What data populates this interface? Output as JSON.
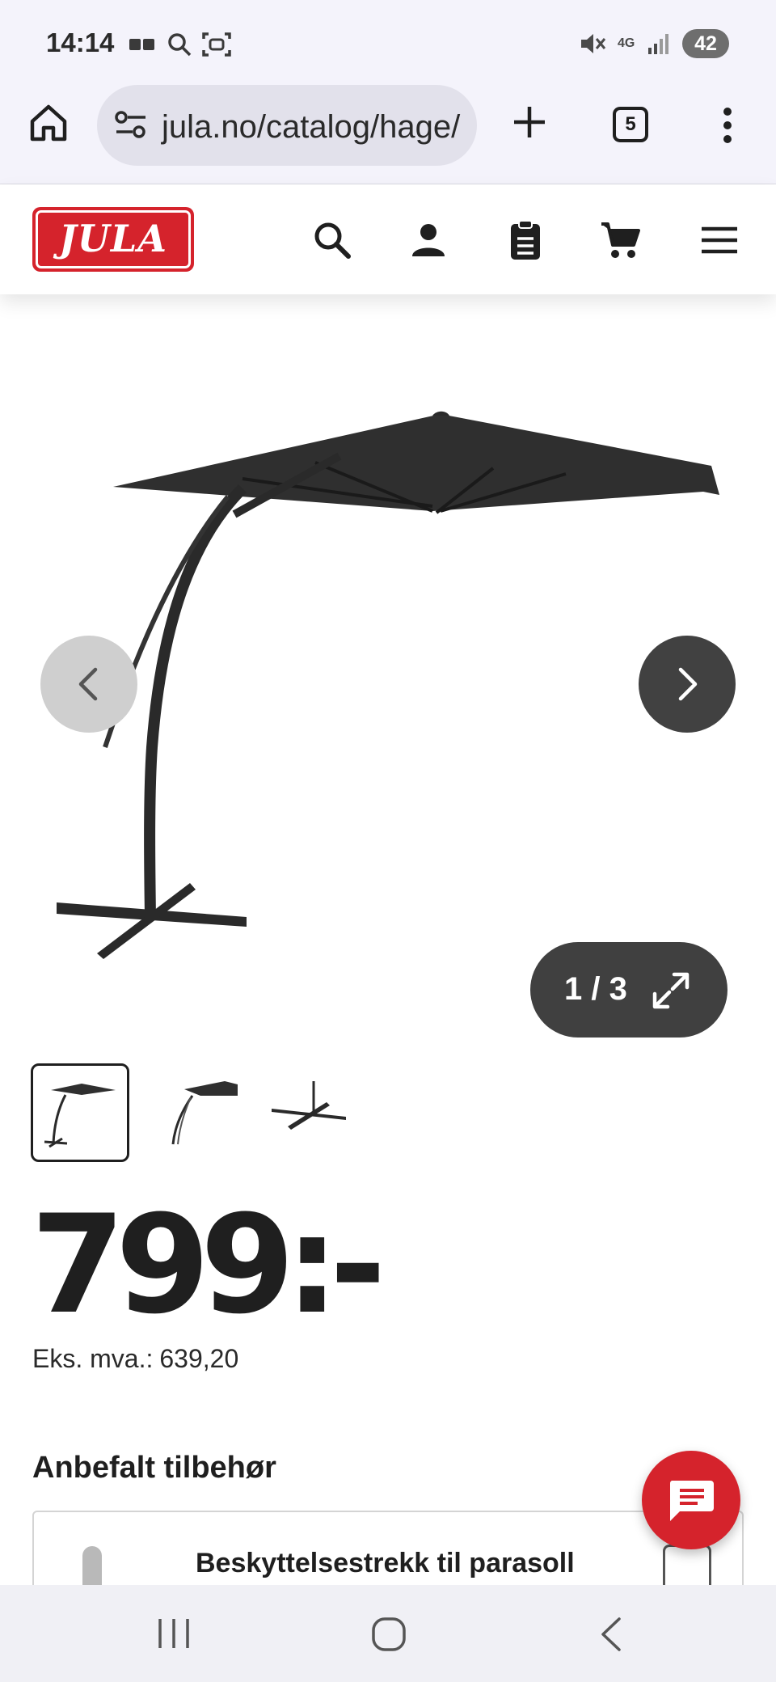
{
  "status_bar": {
    "time": "14:14",
    "battery": "42",
    "network": "4G"
  },
  "browser": {
    "url": "jula.no/catalog/hage/",
    "tab_count": "5"
  },
  "site": {
    "logo_text": "JULA",
    "brand_color": "#d5232c"
  },
  "gallery": {
    "counter": "1 / 3",
    "image_count": 3,
    "active_index": 1
  },
  "product": {
    "price": "799:-",
    "ex_vat_label": "Eks. mva.:",
    "ex_vat_value": "639,20"
  },
  "accessories": {
    "title": "Anbefalt tilbehør",
    "items": [
      {
        "name": "Beskyttelsestrekk til parasoll"
      }
    ]
  },
  "icons": {
    "header": [
      "search-icon",
      "account-icon",
      "shopping-list-icon",
      "cart-icon",
      "hamburger-menu-icon"
    ],
    "gallery": [
      "chevron-left-icon",
      "chevron-right-icon",
      "expand-icon"
    ],
    "chat": "chat-icon"
  }
}
